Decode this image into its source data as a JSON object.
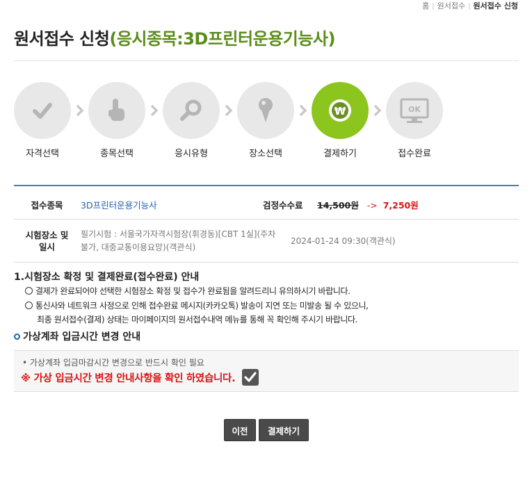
{
  "breadcrumb": {
    "home": "홈",
    "apply": "원서접수",
    "current": "원서접수 신청"
  },
  "title": {
    "main": "원서접수 신청",
    "subject": "(응시종목:3D프린터운용기능사)"
  },
  "steps": [
    {
      "label": "자격선택",
      "icon": "check-icon",
      "active": false
    },
    {
      "label": "종목선택",
      "icon": "touch-hand-icon",
      "active": false
    },
    {
      "label": "응시유형",
      "icon": "magnifier-icon",
      "active": false
    },
    {
      "label": "장소선택",
      "icon": "location-pin-icon",
      "active": false
    },
    {
      "label": "결제하기",
      "icon": "won-coin-icon",
      "active": true
    },
    {
      "label": "접수완료",
      "icon": "ok-monitor-icon",
      "active": false
    }
  ],
  "info": {
    "subject_label": "접수종목",
    "subject_value": "3D프린터운용기능사",
    "fee_label": "검정수수료",
    "fee_original": "14,500원",
    "fee_arrow": "->",
    "fee_discounted": "7,250원",
    "venue_label_1": "시험장소 및",
    "venue_label_2": "일시",
    "venue_line_1": "필기시험 : 서울국가자격시험장(휘경동)[CBT 1실](주차",
    "venue_line_2": "불가, 대중교통이용요망)(객관식)",
    "venue_datetime": "2024-01-24 09:30(객관식)"
  },
  "notice": {
    "title": "1.시험장소 확정 및 결제완료(접수완료) 안내",
    "line1": "결제가 완료되어야 선택한 시험장소 확정 및 접수가 완료됨을 알려드리니 유의하시기 바랍니다.",
    "line2": "통신사와 네트워크 사정으로 인해 접수완료 메시지(카카오톡) 발송이 지연 또는 미발송 될 수 있으니,",
    "line3": "최종 원서접수(결제) 상태는 마이페이지의 원서접수내역 메뉴를 통해 꼭 확인해 주시기 바랍니다."
  },
  "virtual_account": {
    "title": "가상계좌 입금시간 변경 안내",
    "note": "• 가상계좌 입금마감시간 변경으로 반드시 확인 필요",
    "confirm_text": "※ 가상 입금시간 변경 안내사항을 확인 하였습니다.",
    "checked": true
  },
  "buttons": {
    "prev": "이전",
    "pay": "결제하기"
  },
  "colors": {
    "accent_green": "#8cc51e",
    "title_green": "#5a8c1a",
    "link_blue": "#1f5fb0",
    "alert_red": "#dd1111",
    "button_dark": "#4a4a4a"
  }
}
